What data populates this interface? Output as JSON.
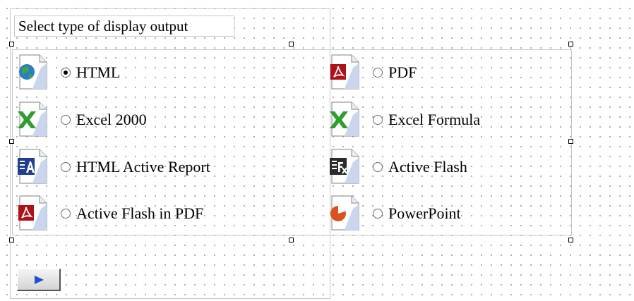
{
  "panel": {
    "title": "Select type of display output"
  },
  "options": [
    {
      "label": "HTML",
      "icon": "globe-document-icon",
      "checked": true
    },
    {
      "label": "PDF",
      "icon": "pdf-document-icon",
      "checked": false
    },
    {
      "label": "Excel 2000",
      "icon": "excel-document-icon",
      "checked": false
    },
    {
      "label": "Excel Formula",
      "icon": "excel-formula-document-icon",
      "checked": false
    },
    {
      "label": "HTML Active Report",
      "icon": "active-report-document-icon",
      "checked": false
    },
    {
      "label": "Active Flash",
      "icon": "active-flash-document-icon",
      "checked": false
    },
    {
      "label": "Active Flash in PDF",
      "icon": "pdf-document-icon",
      "checked": false
    },
    {
      "label": "PowerPoint",
      "icon": "powerpoint-document-icon",
      "checked": false
    }
  ],
  "run_button": {
    "icon": "play-arrow-icon",
    "arrow_color": "#1e50c8"
  },
  "colors": {
    "pdf_red": "#b01018",
    "excel_green": "#2f9e2f",
    "active_blue": "#1f3f8f",
    "powerpoint_orange": "#d9531e"
  }
}
